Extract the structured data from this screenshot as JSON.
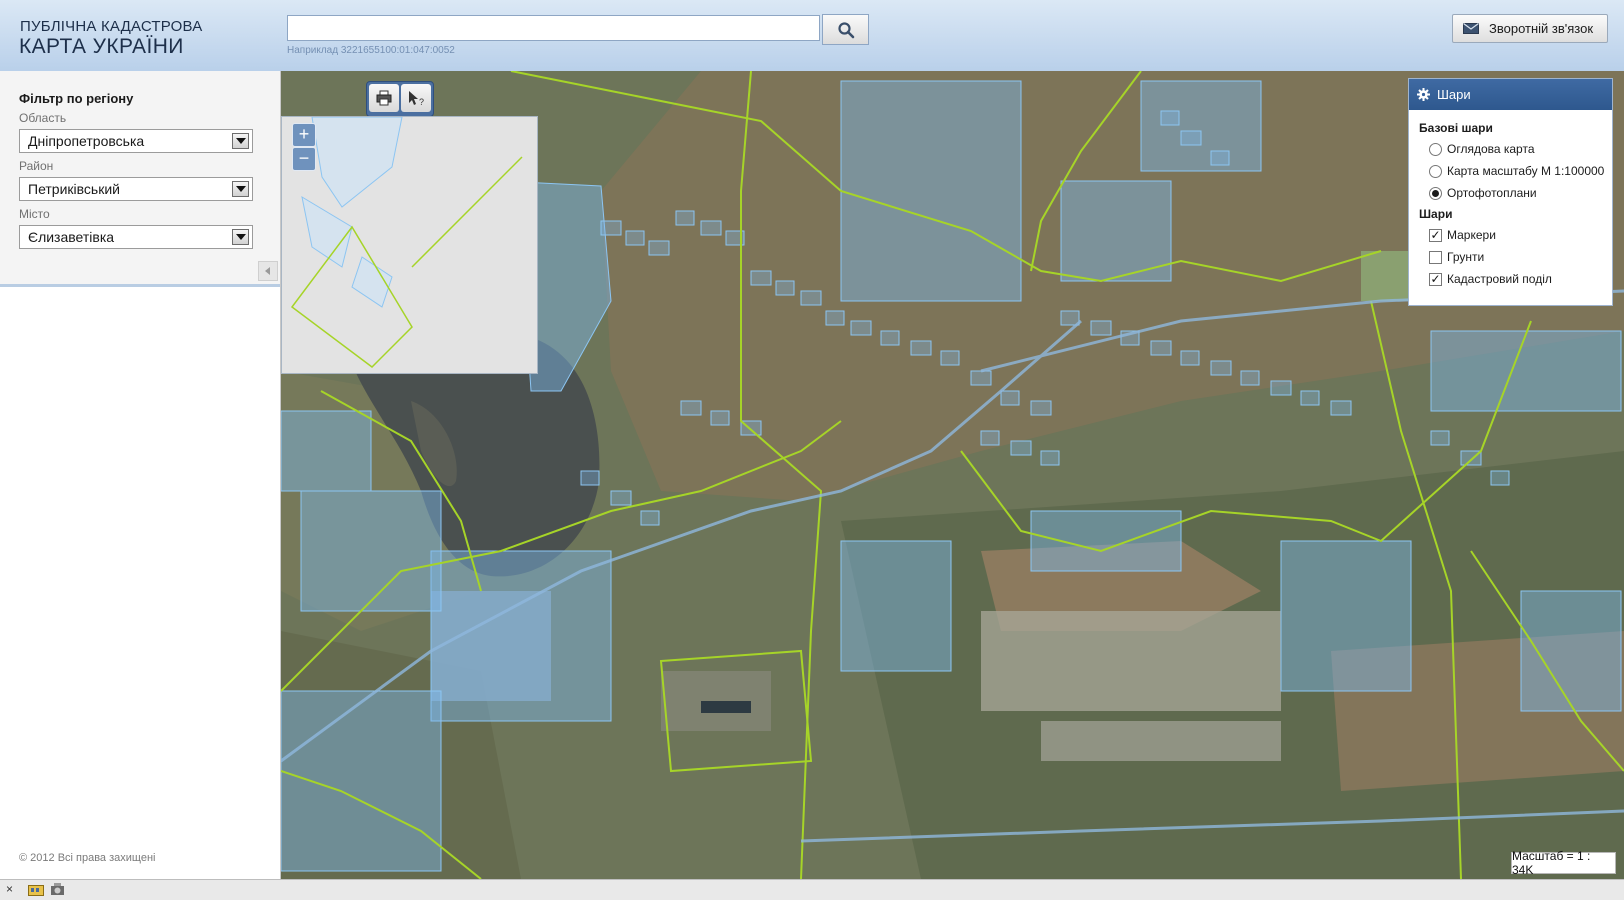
{
  "header": {
    "logo_line1": "ПУБЛІЧНА КАДАСТРОВА",
    "logo_line2": "КАРТА УКРАЇНИ",
    "search": {
      "value": "",
      "hint": "Наприклад 3221655100:01:047:0052"
    },
    "search_icon": "search-icon",
    "feedback_label": "Зворотній зв'язок",
    "feedback_icon": "envelope-icon"
  },
  "sidebar": {
    "title": "Фільтр по регіону",
    "fields": [
      {
        "label": "Область",
        "value": "Дніпропетровська"
      },
      {
        "label": "Район",
        "value": "Петриківський"
      },
      {
        "label": "Місто",
        "value": "Єлизаветівка"
      }
    ],
    "copyright": "© 2012 Всі права захищені"
  },
  "map": {
    "tools": [
      {
        "icon": "print-icon"
      },
      {
        "icon": "identify-cursor-icon"
      }
    ],
    "zoom": {
      "in": "+",
      "out": "−"
    },
    "layers_panel": {
      "title": "Шари",
      "base_title": "Базові шари",
      "base_layers": [
        {
          "label": "Оглядова карта",
          "selected": false
        },
        {
          "label": "Карта масштабу М 1:100000",
          "selected": false
        },
        {
          "label": "Ортофотоплани",
          "selected": true
        }
      ],
      "layers_title": "Шари",
      "layers": [
        {
          "label": "Маркери",
          "checked": true
        },
        {
          "label": "Грунти",
          "checked": false
        },
        {
          "label": "Кадастровий поділ",
          "checked": true
        }
      ]
    },
    "scale": "Масштаб = 1 : 34K"
  },
  "colors": {
    "header_bg": "#c7d9ee",
    "panel_header": "#35609a",
    "parcel_fill": "#7db7ea",
    "boundary_line": "#a6d428"
  }
}
